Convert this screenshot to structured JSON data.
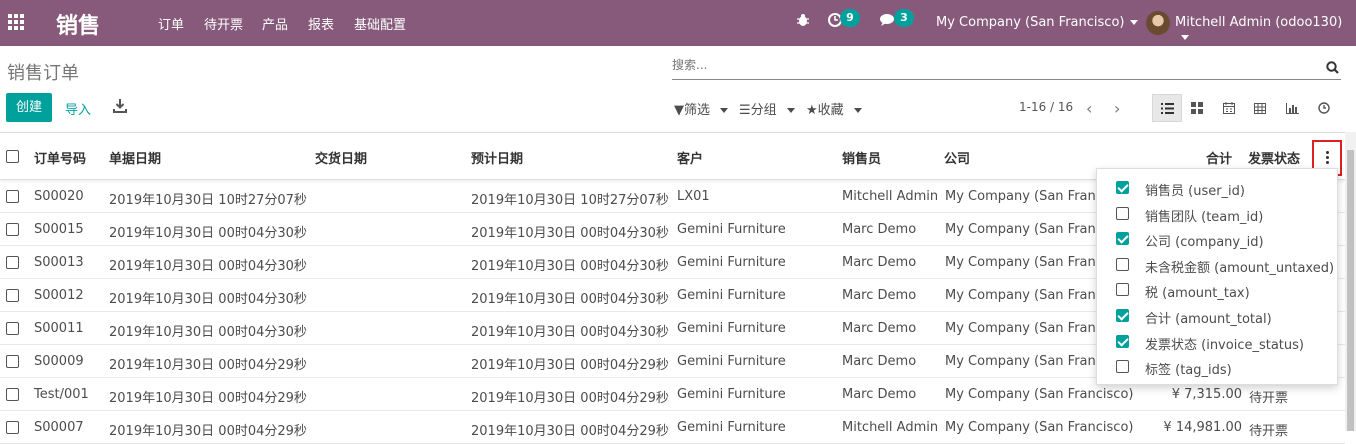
{
  "topbar": {
    "app_name": "销售",
    "menu": [
      "订单",
      "待开票",
      "产品",
      "报表",
      "基础配置"
    ],
    "activity_count": "9",
    "messages_count": "3",
    "company": "My Company (San Francisco)",
    "user": "Mitchell Admin (odoo130)",
    "bar_color": "#875a7b"
  },
  "control": {
    "breadcrumb": "销售订单",
    "search_placeholder": "搜索...",
    "create": "创建",
    "import": "导入",
    "filters": "筛选",
    "group": "分组",
    "favorites": "收藏",
    "pager": "1-16 / 16"
  },
  "table": {
    "headers": [
      "订单号码",
      "单据日期",
      "交货日期",
      "预计日期",
      "客户",
      "销售员",
      "公司",
      "合计",
      "发票状态"
    ],
    "rows": [
      {
        "number": "S00020",
        "date": "2019年10月30日 10时27分07秒",
        "delivery": "",
        "expected": "2019年10月30日 10时27分07秒",
        "customer": "LX01",
        "salesperson": "Mitchell Admin",
        "company": "My Company (San Francis",
        "total": "",
        "invoice_status": ""
      },
      {
        "number": "S00015",
        "date": "2019年10月30日 00时04分30秒",
        "delivery": "",
        "expected": "2019年10月30日 00时04分30秒",
        "customer": "Gemini Furniture",
        "salesperson": "Marc Demo",
        "company": "My Company (San Francis",
        "total": "",
        "invoice_status": ""
      },
      {
        "number": "S00013",
        "date": "2019年10月30日 00时04分30秒",
        "delivery": "",
        "expected": "2019年10月30日 00时04分30秒",
        "customer": "Gemini Furniture",
        "salesperson": "Marc Demo",
        "company": "My Company (San Francis",
        "total": "",
        "invoice_status": ""
      },
      {
        "number": "S00012",
        "date": "2019年10月30日 00时04分30秒",
        "delivery": "",
        "expected": "2019年10月30日 00时04分30秒",
        "customer": "Gemini Furniture",
        "salesperson": "Marc Demo",
        "company": "My Company (San Francis",
        "total": "",
        "invoice_status": ""
      },
      {
        "number": "S00011",
        "date": "2019年10月30日 00时04分30秒",
        "delivery": "",
        "expected": "2019年10月30日 00时04分30秒",
        "customer": "Gemini Furniture",
        "salesperson": "Marc Demo",
        "company": "My Company (San Francis",
        "total": "",
        "invoice_status": ""
      },
      {
        "number": "S00009",
        "date": "2019年10月30日 00时04分29秒",
        "delivery": "",
        "expected": "2019年10月30日 00时04分29秒",
        "customer": "Gemini Furniture",
        "salesperson": "Marc Demo",
        "company": "My Company (San Francis",
        "total": "",
        "invoice_status": ""
      },
      {
        "number": "Test/001",
        "date": "2019年10月30日 00时04分29秒",
        "delivery": "",
        "expected": "2019年10月30日 00时04分29秒",
        "customer": "Gemini Furniture",
        "salesperson": "Marc Demo",
        "company": "My Company (San Francisco)",
        "total": "¥ 7,315.00",
        "invoice_status": "待开票"
      },
      {
        "number": "S00007",
        "date": "2019年10月30日 00时04分29秒",
        "delivery": "",
        "expected": "2019年10月30日 00时04分29秒",
        "customer": "Gemini Furniture",
        "salesperson": "Mitchell Admin",
        "company": "My Company (San Francisco)",
        "total": "¥ 14,981.00",
        "invoice_status": "待开票"
      }
    ]
  },
  "optional_columns": [
    {
      "label": "销售员 (user_id)",
      "checked": true
    },
    {
      "label": "销售团队 (team_id)",
      "checked": false
    },
    {
      "label": "公司 (company_id)",
      "checked": true
    },
    {
      "label": "未含税金额 (amount_untaxed)",
      "checked": false
    },
    {
      "label": "税 (amount_tax)",
      "checked": false
    },
    {
      "label": "合计 (amount_total)",
      "checked": true
    },
    {
      "label": "发票状态 (invoice_status)",
      "checked": true
    },
    {
      "label": "标签 (tag_ids)",
      "checked": false
    }
  ],
  "colors": {
    "accent": "#00a09d",
    "highlight": "#e01f1f"
  }
}
